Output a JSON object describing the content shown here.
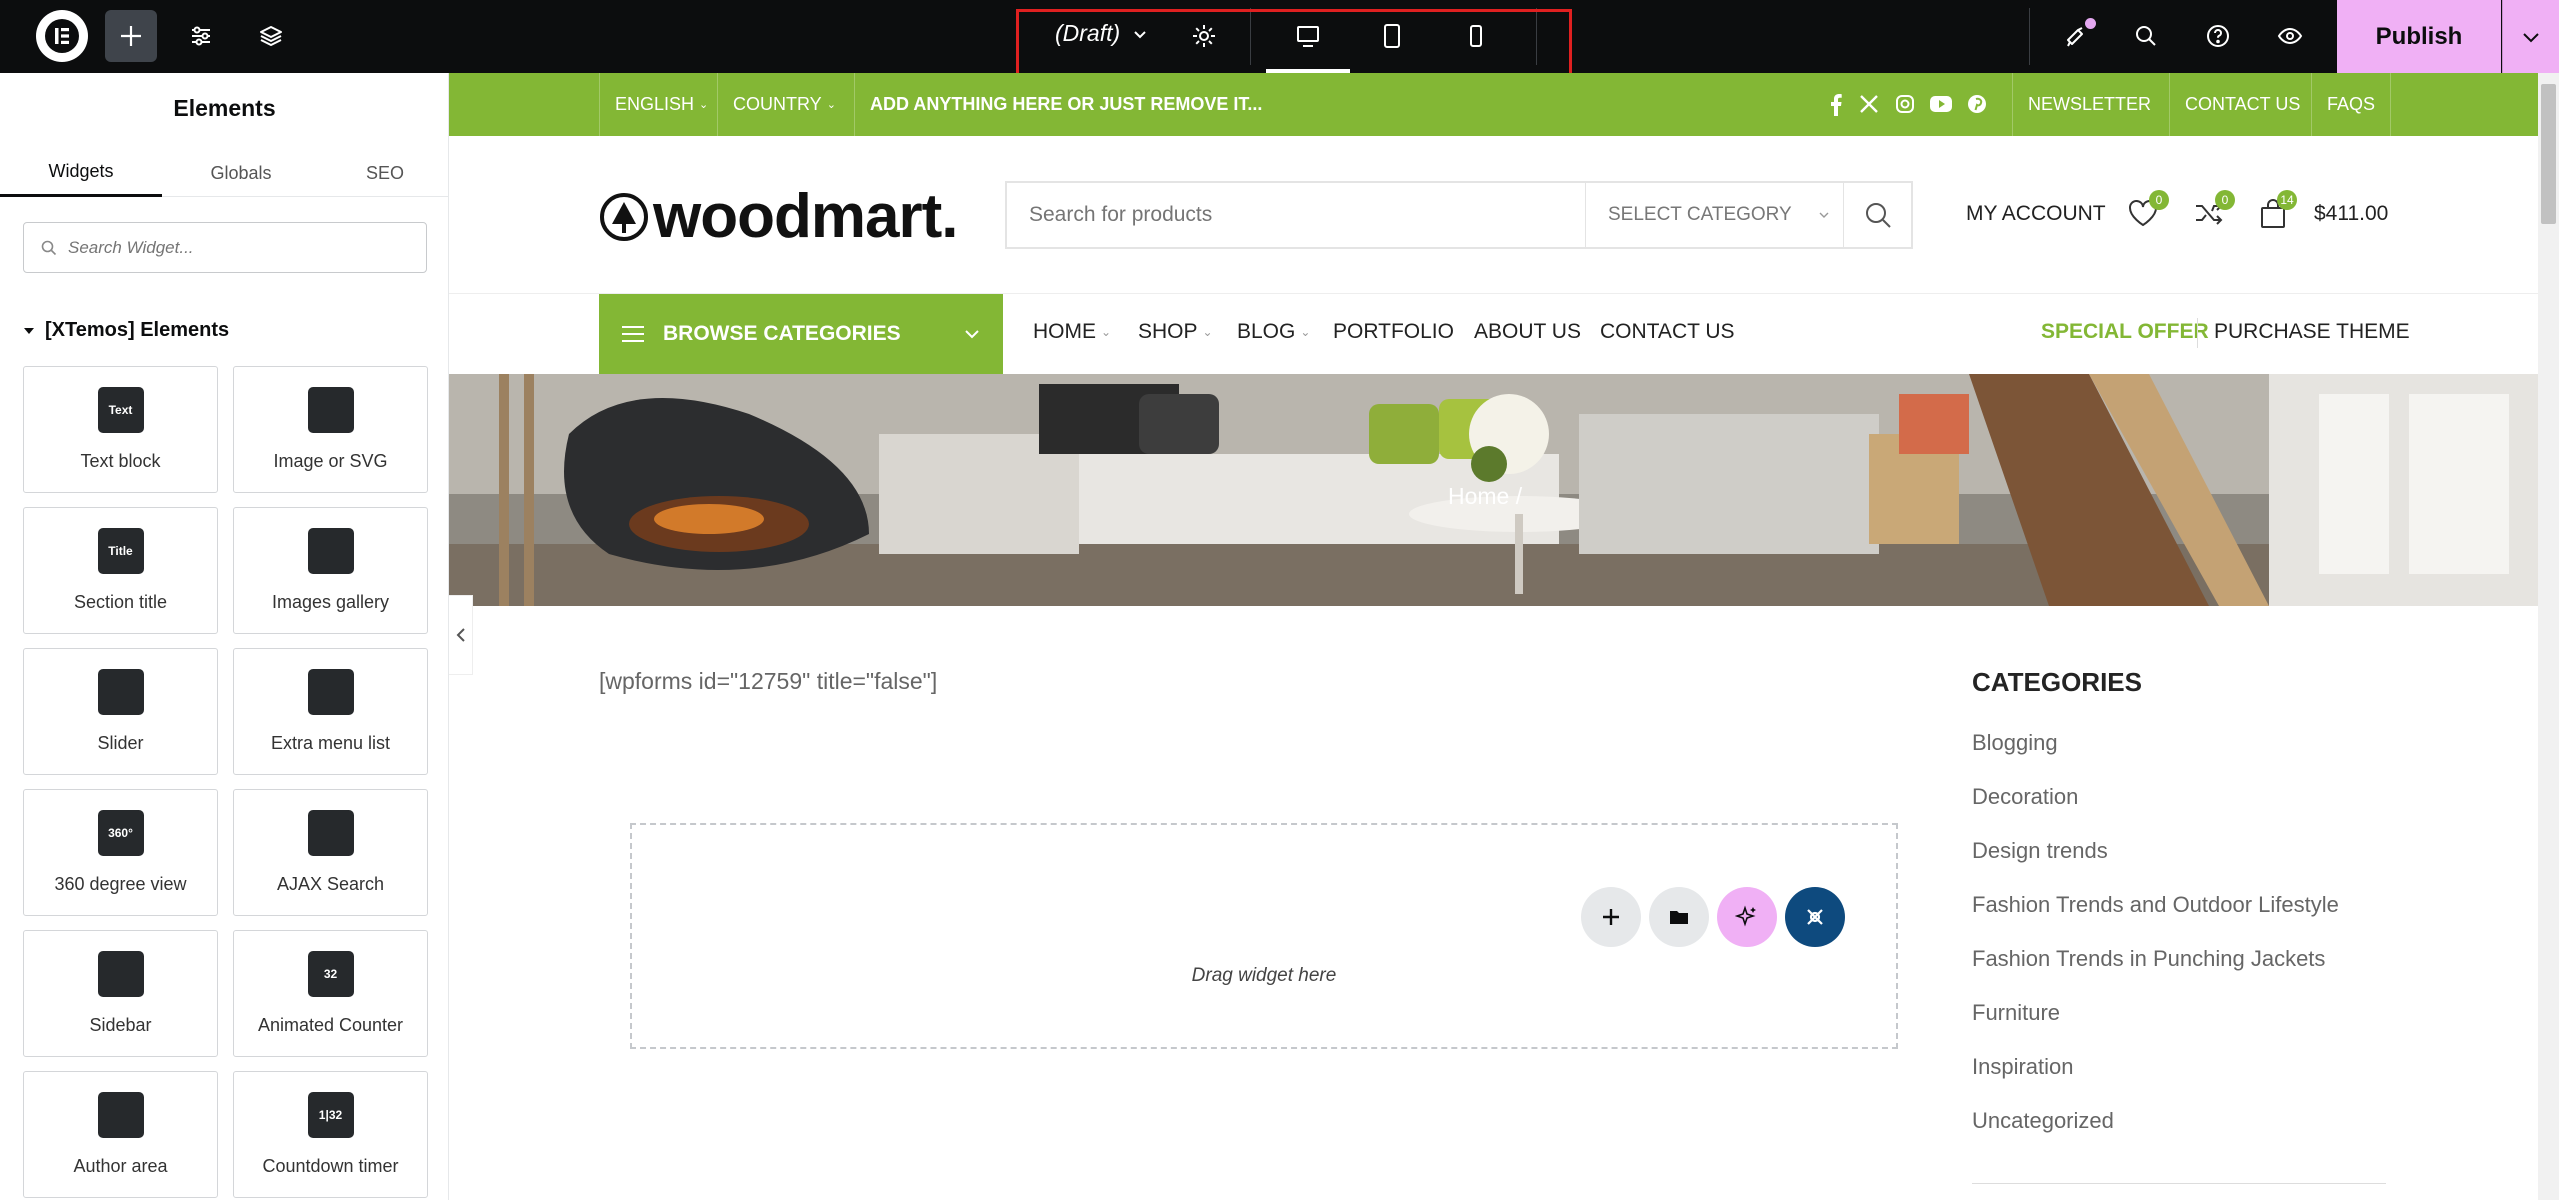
{
  "topbar": {
    "draft_label": "(Draft)",
    "publish_label": "Publish"
  },
  "panel": {
    "title": "Elements",
    "tabs": [
      "Widgets",
      "Globals",
      "SEO"
    ],
    "search_placeholder": "Search Widget...",
    "section_title": "[XTemos] Elements",
    "widgets": [
      {
        "label": "Text block",
        "icon": "text-block-icon",
        "glyph": "Text"
      },
      {
        "label": "Image or SVG",
        "icon": "image-svg-icon",
        "glyph": ""
      },
      {
        "label": "Section title",
        "icon": "section-title-icon",
        "glyph": "Title"
      },
      {
        "label": "Images gallery",
        "icon": "images-gallery-icon",
        "glyph": ""
      },
      {
        "label": "Slider",
        "icon": "slider-icon",
        "glyph": ""
      },
      {
        "label": "Extra menu list",
        "icon": "extra-menu-list-icon",
        "glyph": ""
      },
      {
        "label": "360 degree view",
        "icon": "360-view-icon",
        "glyph": "360°"
      },
      {
        "label": "AJAX Search",
        "icon": "ajax-search-icon",
        "glyph": ""
      },
      {
        "label": "Sidebar",
        "icon": "sidebar-icon",
        "glyph": ""
      },
      {
        "label": "Animated Counter",
        "icon": "animated-counter-icon",
        "glyph": "32"
      },
      {
        "label": "Author area",
        "icon": "author-area-icon",
        "glyph": ""
      },
      {
        "label": "Countdown timer",
        "icon": "countdown-timer-icon",
        "glyph": "1|32"
      }
    ]
  },
  "site": {
    "topstrip": {
      "language": "ENGLISH",
      "country": "COUNTRY",
      "promo": "ADD ANYTHING HERE OR JUST REMOVE IT...",
      "links": [
        "NEWSLETTER",
        "CONTACT US",
        "FAQS"
      ]
    },
    "brand": "woodmart.",
    "search_placeholder": "Search for products",
    "category_select": "SELECT CATEGORY",
    "my_account": "MY ACCOUNT",
    "wishlist_count": "0",
    "compare_count": "0",
    "cart_count": "14",
    "cart_total": "$411.00",
    "browse_categories": "BROWSE CATEGORIES",
    "nav": [
      "HOME",
      "SHOP",
      "BLOG",
      "PORTFOLIO",
      "ABOUT US",
      "CONTACT US"
    ],
    "special_offer": "SPECIAL OFFER",
    "purchase_theme": "PURCHASE THEME",
    "breadcrumb": "Home  /",
    "shortcode": "[wpforms id=\"12759\" title=\"false\"]",
    "dropzone_text": "Drag widget here",
    "categories_heading": "CATEGORIES",
    "categories": [
      "Blogging",
      "Decoration",
      "Design trends",
      "Fashion Trends and Outdoor Lifestyle",
      "Fashion Trends in Punching Jackets",
      "Furniture",
      "Inspiration",
      "Uncategorized"
    ]
  },
  "colors": {
    "accent_green": "#83b735",
    "publish_pink": "#f0b0f5",
    "topbar_bg": "#0c0d0e"
  }
}
